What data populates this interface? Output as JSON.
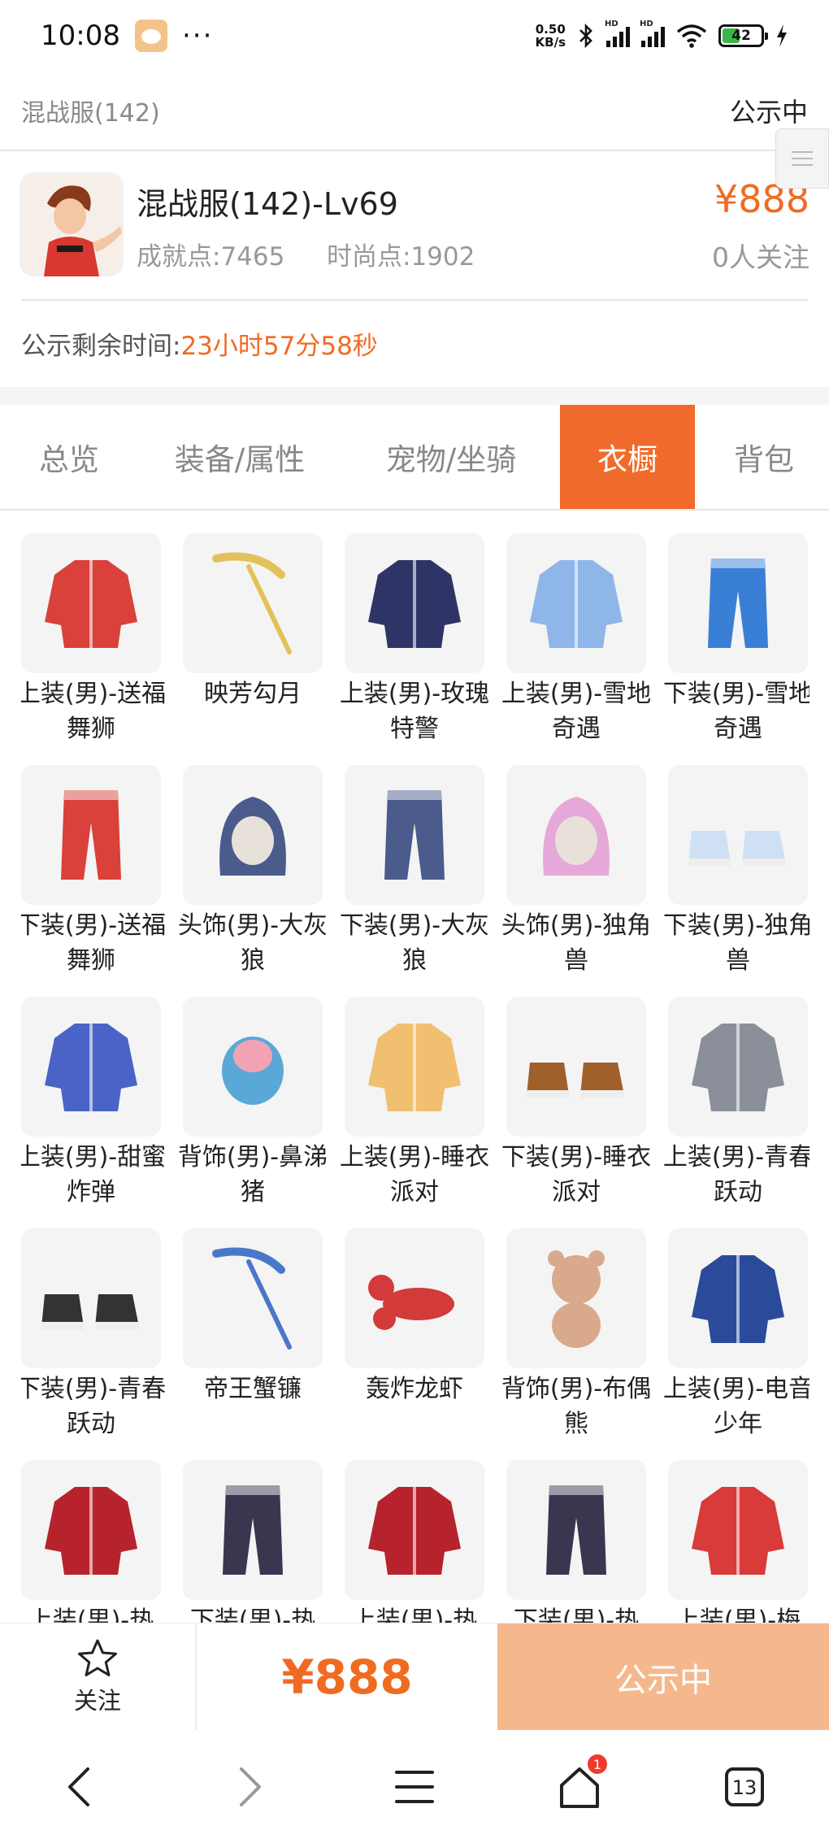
{
  "status_bar": {
    "time": "10:08",
    "more": "···",
    "net_speed_value": "0.50",
    "net_speed_unit": "KB/s",
    "battery": "42"
  },
  "header": {
    "server": "混战服(142)",
    "status": "公示中"
  },
  "character": {
    "name": "混战服(142)-Lv69",
    "achievement": "成就点:7465",
    "fashion": "时尚点:1902",
    "price": "¥888",
    "followers": "0人关注",
    "timer_label": "公示剩余时间:",
    "timer_value": "23小时57分58秒"
  },
  "tabs": [
    {
      "label": "总览"
    },
    {
      "label": "装备/属性"
    },
    {
      "label": "宠物/坐骑"
    },
    {
      "label": "衣橱",
      "active": true
    },
    {
      "label": "背包"
    }
  ],
  "items": [
    {
      "name": "上装(男)-送福舞狮",
      "icon": "lion-dance-top-icon",
      "color": "#d9413a"
    },
    {
      "name": "映芳勾月",
      "icon": "golden-staff-icon",
      "color": "#e3c15a"
    },
    {
      "name": "上装(男)-玫瑰特警",
      "icon": "police-coat-icon",
      "color": "#2e3566"
    },
    {
      "name": "上装(男)-雪地奇遇",
      "icon": "snow-coat-icon",
      "color": "#8fb6e8"
    },
    {
      "name": "下装(男)-雪地奇遇",
      "icon": "snow-shorts-icon",
      "color": "#3a7fd6"
    },
    {
      "name": "下装(男)-送福舞狮",
      "icon": "lion-dance-pants-icon",
      "color": "#d9413a"
    },
    {
      "name": "头饰(男)-大灰狼",
      "icon": "wolf-hood-icon",
      "color": "#4a5b8c"
    },
    {
      "name": "下装(男)-大灰狼",
      "icon": "wolf-pants-icon",
      "color": "#4a5b8c"
    },
    {
      "name": "头饰(男)-独角兽",
      "icon": "unicorn-hood-icon",
      "color": "#e6a8d8"
    },
    {
      "name": "下装(男)-独角兽",
      "icon": "unicorn-shoes-icon",
      "color": "#cfe0f5"
    },
    {
      "name": "上装(男)-甜蜜炸弹",
      "icon": "sweet-bomb-coat-icon",
      "color": "#4a63c7"
    },
    {
      "name": "背饰(男)-鼻涕猪",
      "icon": "pig-backpack-icon",
      "color": "#5aa8d8"
    },
    {
      "name": "上装(男)-睡衣派对",
      "icon": "pajama-top-icon",
      "color": "#f0c070"
    },
    {
      "name": "下装(男)-睡衣派对",
      "icon": "pajama-slippers-icon",
      "color": "#a0602a"
    },
    {
      "name": "上装(男)-青春跃动",
      "icon": "youth-jacket-icon",
      "color": "#8a8f99"
    },
    {
      "name": "下装(男)-青春跃动",
      "icon": "sneakers-icon",
      "color": "#333333"
    },
    {
      "name": "帝王蟹镰",
      "icon": "crab-scythe-icon",
      "color": "#4a78c8"
    },
    {
      "name": "轰炸龙虾",
      "icon": "lobster-icon",
      "color": "#d33a3a"
    },
    {
      "name": "背饰(男)-布偶熊",
      "icon": "teddy-bear-icon",
      "color": "#d8a98a"
    },
    {
      "name": "上装(男)-电音少年",
      "icon": "varsity-jacket-icon",
      "color": "#2b4a9a"
    },
    {
      "name": "上装(男)-热",
      "icon": "red-black-jacket-icon",
      "color": "#b7232c"
    },
    {
      "name": "下装(男)-热",
      "icon": "leggings-icon",
      "color": "#3a3650"
    },
    {
      "name": "上装(男)-热",
      "icon": "red-black-jacket-icon",
      "color": "#b7232c"
    },
    {
      "name": "下装(男)-热",
      "icon": "leggings-icon",
      "color": "#3a3650"
    },
    {
      "name": "上装(男)-梅",
      "icon": "red-robe-icon",
      "color": "#d93a3a"
    }
  ],
  "action_bar": {
    "follow_label": "关注",
    "price": "¥888",
    "status": "公示中"
  },
  "nav": {
    "home_badge": "1",
    "tabs_count": "13"
  },
  "colors": {
    "accent": "#f06b2b",
    "price": "#f06b22",
    "status_button": "#f5b88d"
  }
}
